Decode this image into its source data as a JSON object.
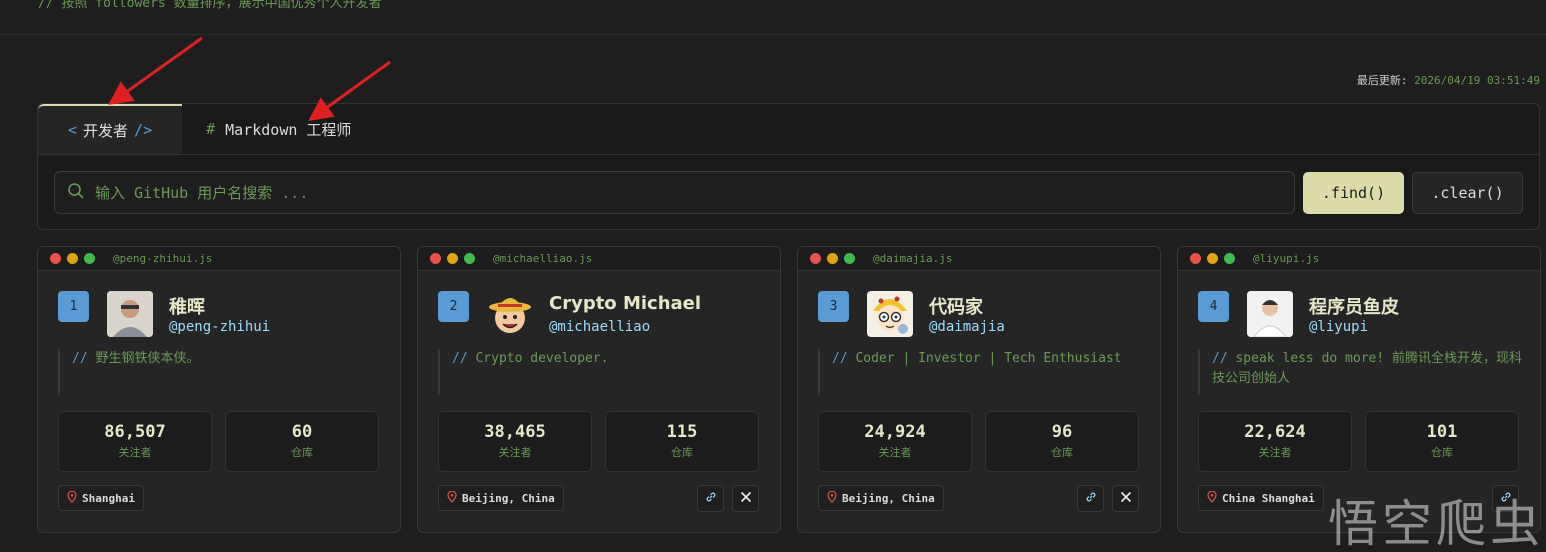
{
  "header": {
    "comment": "// 按照 followers 数量排序，展示中国优秀个人开发者",
    "last_updated_label": "最后更新:",
    "last_updated_value": "2026/04/19 03:51:49"
  },
  "tabs": [
    {
      "prefix": "<",
      "label": "开发者",
      "suffix": "/>",
      "active": true
    },
    {
      "prefix": "#",
      "label": "Markdown 工程师",
      "active": false
    }
  ],
  "search": {
    "placeholder": "输入 GitHub 用户名搜索 ...",
    "find_label": ".find()",
    "clear_label": ".clear()"
  },
  "cards": [
    {
      "file": "@peng-zhihui.js",
      "rank": "1",
      "name": "稚晖",
      "handle": "@peng-zhihui",
      "bio_slashes": "//",
      "bio": "野生钢铁侠本侠。",
      "followers": "86,507",
      "followers_label": "关注者",
      "repos": "60",
      "repos_label": "仓库",
      "location": "Shanghai",
      "avatar_icon": "photo-avatar-icon",
      "socials": []
    },
    {
      "file": "@michaelliao.js",
      "rank": "2",
      "name": "Crypto Michael",
      "handle": "@michaelliao",
      "bio_slashes": "//",
      "bio": "Crypto developer.",
      "followers": "38,465",
      "followers_label": "关注者",
      "repos": "115",
      "repos_label": "仓库",
      "location": "Beijing, China",
      "avatar_icon": "straw-hat-avatar-icon",
      "socials": [
        "link",
        "x"
      ]
    },
    {
      "file": "@daimajia.js",
      "rank": "3",
      "name": "代码家",
      "handle": "@daimajia",
      "bio_slashes": "//",
      "bio": "Coder | Investor | Tech Enthusiast",
      "followers": "24,924",
      "followers_label": "关注者",
      "repos": "96",
      "repos_label": "仓库",
      "location": "Beijing, China",
      "avatar_icon": "cartoon-avatar-icon",
      "socials": [
        "link",
        "x"
      ]
    },
    {
      "file": "@liyupi.js",
      "rank": "4",
      "name": "程序员鱼皮",
      "handle": "@liyupi",
      "bio_slashes": "//",
      "bio": "speak less do more! 前腾讯全栈开发，现科技公司创始人",
      "followers": "22,624",
      "followers_label": "关注者",
      "repos": "101",
      "repos_label": "仓库",
      "location": "China Shanghai",
      "avatar_icon": "photo-avatar-icon",
      "socials": [
        "link"
      ]
    }
  ],
  "watermark": "悟空爬虫",
  "colors": {
    "background": "#1e1e1e",
    "accent_yellow": "#dcdcaa",
    "comment_green": "#6a9955",
    "keyword_blue": "#569cd6",
    "rank_blue": "#5b9bd5",
    "annotation_red": "#e02020"
  }
}
